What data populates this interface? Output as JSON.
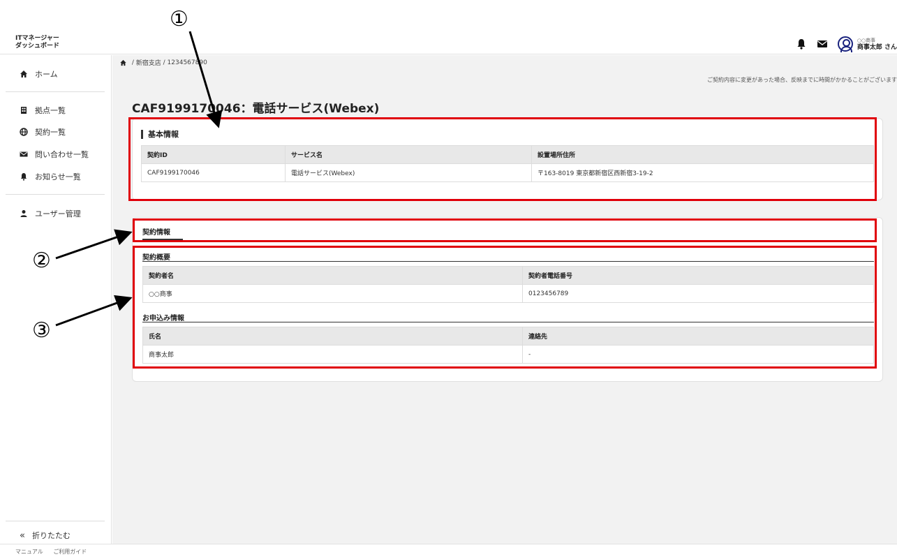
{
  "header": {
    "logo_line1": "ITマネージャー",
    "logo_line2": "ダッシュボード",
    "company": "○○商事",
    "user_name": "商事太郎 さん"
  },
  "sidebar": {
    "items": [
      {
        "label": "ホーム",
        "icon": "home-icon"
      },
      {
        "label": "拠点一覧",
        "icon": "building-icon"
      },
      {
        "label": "契約一覧",
        "icon": "globe-icon"
      },
      {
        "label": "問い合わせ一覧",
        "icon": "mail-icon"
      },
      {
        "label": "お知らせ一覧",
        "icon": "bell-icon"
      },
      {
        "label": "ユーザー管理",
        "icon": "user-icon"
      }
    ],
    "collapse_label": "折りたたむ"
  },
  "footer": {
    "manual": "マニュアル",
    "guide": "ご利用ガイド"
  },
  "breadcrumb": {
    "shop": "新宿支店",
    "contract": "1234567890"
  },
  "notice": "ご契約内容に変更があった場合、反映までに時間がかかることがございます",
  "page_title": "CAF9199170046：電話サービス(Webex)",
  "basic_info": {
    "heading": "基本情報",
    "headers": [
      "契約ID",
      "サービス名",
      "設置場所住所"
    ],
    "row": [
      "CAF9199170046",
      "電話サービス(Webex)",
      "〒163-8019 東京都新宿区西新宿3-19-2"
    ]
  },
  "contract_info": {
    "tab": "契約情報",
    "overview": {
      "heading": "契約概要",
      "headers": [
        "契約者名",
        "契約者電話番号"
      ],
      "row": [
        "○○商事",
        "0123456789"
      ]
    },
    "application": {
      "heading": "お申込み情報",
      "headers": [
        "氏名",
        "連絡先"
      ],
      "row": [
        "商事太郎",
        "-"
      ]
    }
  },
  "annotations": {
    "m1": "①",
    "m2": "②",
    "m3": "③"
  },
  "colors": {
    "annotation_red": "#e0000a",
    "brand_navy": "#1a237e"
  }
}
